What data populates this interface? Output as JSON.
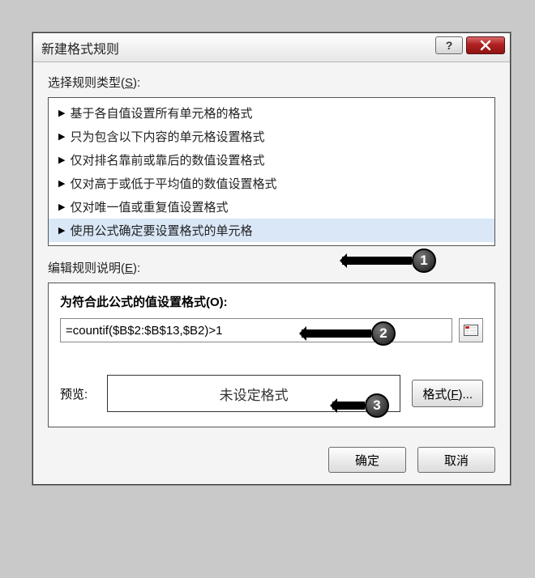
{
  "dialog": {
    "title": "新建格式规则"
  },
  "section": {
    "select_rule_type_label": "选择规则类型(",
    "select_rule_type_mn": "S",
    "select_rule_type_close": "):",
    "edit_rule_desc_label": "编辑规则说明(",
    "edit_rule_desc_mn": "E",
    "edit_rule_desc_close": "):"
  },
  "rule_types": [
    "基于各自值设置所有单元格的格式",
    "只为包含以下内容的单元格设置格式",
    "仅对排名靠前或靠后的数值设置格式",
    "仅对高于或低于平均值的数值设置格式",
    "仅对唯一值或重复值设置格式",
    "使用公式确定要设置格式的单元格"
  ],
  "selected_rule_index": 5,
  "edit": {
    "sub_label": "为符合此公式的值设置格式(",
    "sub_mn": "O",
    "sub_close": "):",
    "formula_value": "=countif($B$2:$B$13,$B2)>1",
    "preview_label": "预览:",
    "preview_text": "未设定格式",
    "format_button": "格式(",
    "format_mn": "F",
    "format_close": ")..."
  },
  "footer": {
    "ok": "确定",
    "cancel": "取消"
  },
  "callouts": {
    "c1": "1",
    "c2": "2",
    "c3": "3"
  }
}
